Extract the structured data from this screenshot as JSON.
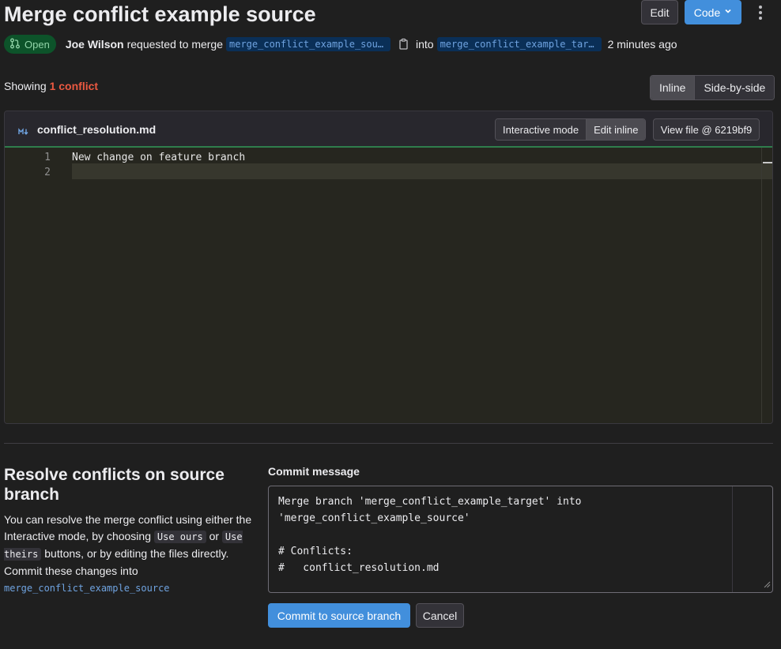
{
  "page": {
    "title": "Merge conflict example source"
  },
  "header": {
    "edit_label": "Edit",
    "code_label": "Code",
    "status": "Open",
    "author": "Joe Wilson",
    "requested_text": "requested to merge",
    "source_branch": "merge_conflict_example_sour…",
    "into_text": "into",
    "target_branch": "merge_conflict_example_targ…",
    "time_ago": "2 minutes ago",
    "status_color": "#91d4a8",
    "accent_color": "#428fdc"
  },
  "conflicts": {
    "showing_text": "Showing",
    "count_text": "1 conflict",
    "count_color": "#ec5941",
    "view_modes": [
      "Inline",
      "Side-by-side"
    ],
    "active_view": "Inline"
  },
  "file": {
    "name": "conflict_resolution.md",
    "modes": [
      "Interactive mode",
      "Edit inline"
    ],
    "active_mode": "Edit inline",
    "view_file_label": "View file @ 6219bf9",
    "lines": [
      {
        "number": "1",
        "text": "New change on feature branch"
      },
      {
        "number": "2",
        "text": ""
      }
    ]
  },
  "resolve": {
    "title": "Resolve conflicts on source branch",
    "desc_1": "You can resolve the merge conflict using either the Interactive mode, by choosing",
    "use_ours": "Use ours",
    "desc_or": "or",
    "use_theirs": "Use theirs",
    "desc_2": "buttons, or by editing the files directly. Commit these changes into",
    "branch": "merge_conflict_example_source"
  },
  "commit": {
    "label": "Commit message",
    "message": "Merge branch 'merge_conflict_example_target' into\n'merge_conflict_example_source'\n\n# Conflicts:\n#   conflict_resolution.md",
    "commit_label": "Commit to source branch",
    "cancel_label": "Cancel"
  }
}
